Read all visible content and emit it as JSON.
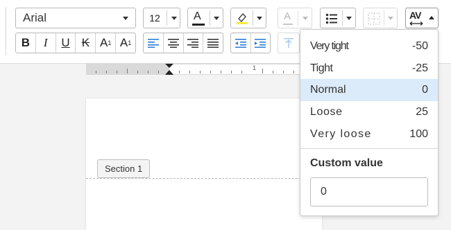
{
  "toolbar": {
    "font_family": "Arial",
    "font_size": "12",
    "text_color_letter": "A",
    "text_color_accent": "#222222",
    "highlight_color": "#ffeb3b",
    "spacing_letters": "AV",
    "format_buttons": [
      "B",
      "I",
      "U",
      "K",
      "A",
      "A"
    ],
    "superscript_mark": "1",
    "subscript_mark": "1",
    "colors": {
      "accent": "#2a7bd5",
      "selected": "#dcebf9"
    }
  },
  "ruler": {
    "mark": "1"
  },
  "document": {
    "section_label": "Section 1"
  },
  "letter_spacing_menu": {
    "options": [
      {
        "label": "Very tight",
        "value": "-50",
        "selected": false
      },
      {
        "label": "Tight",
        "value": "-25",
        "selected": false
      },
      {
        "label": "Normal",
        "value": "0",
        "selected": true
      },
      {
        "label": "Loose",
        "value": "25",
        "selected": false
      },
      {
        "label": "Very loose",
        "value": "100",
        "selected": false
      }
    ],
    "custom_label": "Custom value",
    "custom_value": "0"
  }
}
